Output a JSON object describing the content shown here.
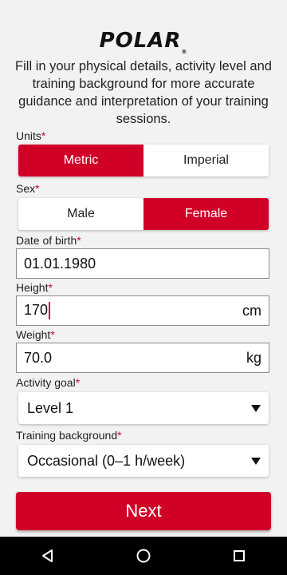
{
  "brand": {
    "logo_text": "POLAR"
  },
  "intro_text": "Fill in your physical details, activity level and training background for more accurate guidance and interpretation of your training sessions.",
  "accent_color": "#d10027",
  "units": {
    "label": "Units",
    "required_mark": "*",
    "options": [
      "Metric",
      "Imperial"
    ],
    "selected": "Metric"
  },
  "sex": {
    "label": "Sex",
    "required_mark": "*",
    "options": [
      "Male",
      "Female"
    ],
    "selected": "Female"
  },
  "dob": {
    "label": "Date of birth",
    "required_mark": "*",
    "value": "01.01.1980"
  },
  "height": {
    "label": "Height",
    "required_mark": "*",
    "value": "170",
    "unit": "cm"
  },
  "weight": {
    "label": "Weight",
    "required_mark": "*",
    "value": "70.0",
    "unit": "kg"
  },
  "activity_goal": {
    "label": "Activity goal",
    "required_mark": "*",
    "selected": "Level 1"
  },
  "training_background": {
    "label": "Training background",
    "required_mark": "*",
    "selected": "Occasional (0–1 h/week)"
  },
  "next_label": "Next",
  "navbar": {
    "icons": [
      "back-icon",
      "home-icon",
      "recents-icon"
    ]
  }
}
